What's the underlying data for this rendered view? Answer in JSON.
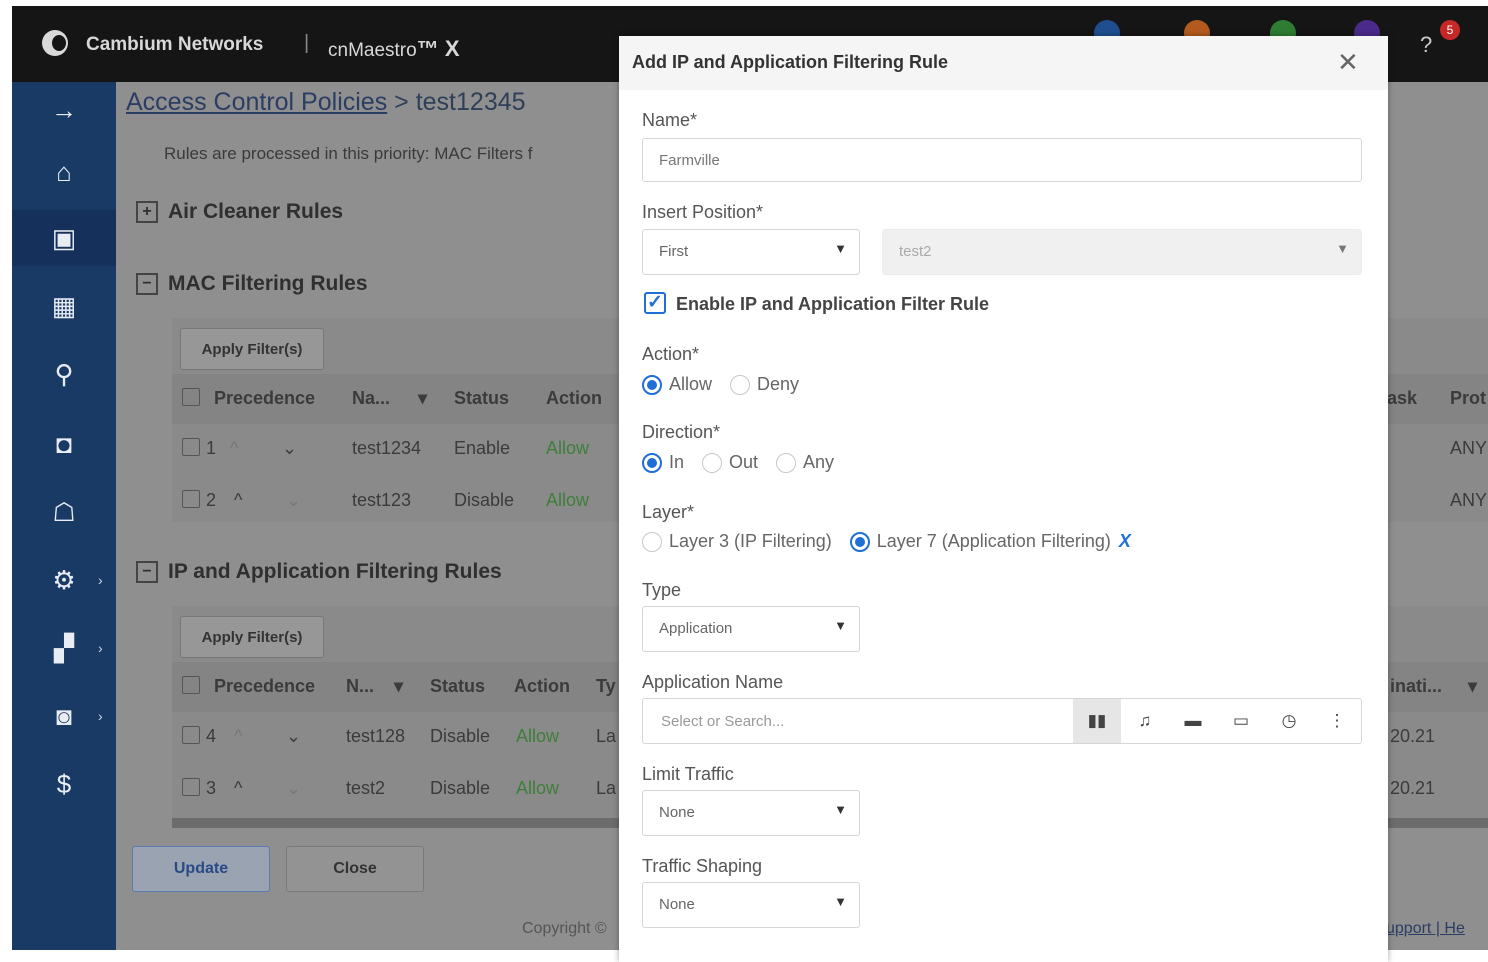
{
  "header": {
    "brand": "Cambium Networks",
    "separator": "|",
    "product": "cnMaestro",
    "product_suffix": "™ X",
    "notification_colors": [
      "#1f4e8f",
      "#b35a1f",
      "#2e7d32",
      "#4a2a8a"
    ],
    "alert_count": "5"
  },
  "sidebar": {
    "items": [
      {
        "icon": "arrow-right-icon",
        "glyph": "→"
      },
      {
        "icon": "home-icon",
        "glyph": "⌂"
      },
      {
        "icon": "monitor-icon",
        "glyph": "▣"
      },
      {
        "icon": "table-icon",
        "glyph": "▦"
      },
      {
        "icon": "location-pin-icon",
        "glyph": "⚲"
      },
      {
        "icon": "device-icon",
        "glyph": "◘"
      },
      {
        "icon": "user-device-icon",
        "glyph": "☖"
      },
      {
        "icon": "gear-icon",
        "glyph": "⚙"
      },
      {
        "icon": "apps-icon",
        "glyph": "▞"
      },
      {
        "icon": "screen-icon",
        "glyph": "◙"
      },
      {
        "icon": "license-icon",
        "glyph": "$"
      }
    ]
  },
  "main": {
    "breadcrumb_link": "Access Control Policies",
    "breadcrumb_rest": " > test12345",
    "note": "Rules are processed in this priority: MAC Filters f",
    "air_cleaner": "Air Cleaner Rules",
    "mac_section": "MAC Filtering Rules",
    "ip_section": "IP and Application Filtering Rules",
    "apply_filters": "Apply Filter(s)",
    "mac_headers": {
      "precedence": "Precedence",
      "name": "Na...",
      "status": "Status",
      "action": "Action",
      "mask": "lask",
      "protocol": "Prot"
    },
    "mac_rows": [
      {
        "prec": "1",
        "name": "test1234",
        "status": "Enable",
        "action": "Allow",
        "protocol": "ANY"
      },
      {
        "prec": "2",
        "name": "test123",
        "status": "Disable",
        "action": "Allow",
        "protocol": "ANY"
      }
    ],
    "ip_headers": {
      "precedence": "Precedence",
      "name": "N...",
      "status": "Status",
      "action": "Action",
      "type": "Ty",
      "destination": "inati..."
    },
    "ip_rows": [
      {
        "prec": "4",
        "name": "test128",
        "status": "Disable",
        "action": "Allow",
        "type": "La",
        "dest": "20.21"
      },
      {
        "prec": "3",
        "name": "test2",
        "status": "Disable",
        "action": "Allow",
        "type": "La",
        "dest": "20.21"
      }
    ],
    "update": "Update",
    "close": "Close",
    "copyright": "Copyright ©",
    "support": "upport | He"
  },
  "modal": {
    "title": "Add IP and Application Filtering Rule",
    "name_label": "Name*",
    "name_value": "Farmville",
    "insert_label": "Insert Position*",
    "insert_value": "First",
    "insert_ref": "test2",
    "enable_label": "Enable IP and Application Filter Rule",
    "action_label": "Action*",
    "action_allow": "Allow",
    "action_deny": "Deny",
    "direction_label": "Direction*",
    "dir_in": "In",
    "dir_out": "Out",
    "dir_any": "Any",
    "layer_label": "Layer*",
    "layer3": "Layer 3 (IP Filtering)",
    "layer7": "Layer 7 (Application Filtering)",
    "type_label": "Type",
    "type_value": "Application",
    "app_label": "Application Name",
    "app_placeholder": "Select or Search...",
    "limit_label": "Limit Traffic",
    "limit_value": "None",
    "shaping_label": "Traffic Shaping",
    "shaping_value": "None"
  }
}
